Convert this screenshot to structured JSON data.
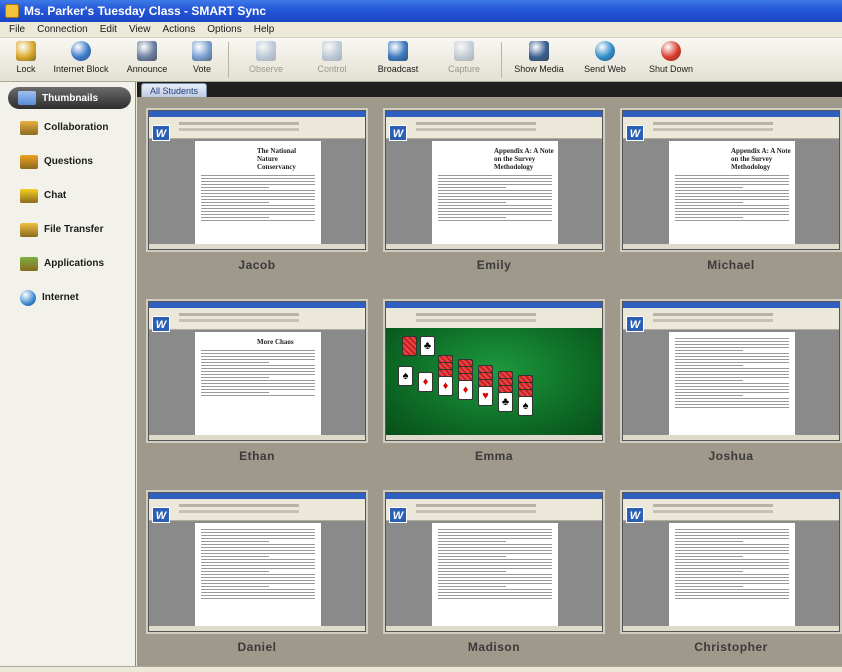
{
  "window": {
    "title": "Ms. Parker's Tuesday Class - SMART Sync"
  },
  "menu": [
    "File",
    "Connection",
    "Edit",
    "View",
    "Actions",
    "Options",
    "Help"
  ],
  "toolbar": [
    {
      "label": "Lock",
      "icon": "lock-icon",
      "color": "#d8a928",
      "enabled": true
    },
    {
      "label": "Internet Block",
      "icon": "globe-block-icon",
      "color": "#3a78c8",
      "enabled": true
    },
    {
      "label": "Announce",
      "icon": "announce-icon",
      "color": "#6b7fa0",
      "enabled": true
    },
    {
      "label": "Vote",
      "icon": "vote-icon",
      "color": "#7aa0d0",
      "enabled": true
    },
    {
      "label": "Observe",
      "icon": "observe-icon",
      "color": "#7a99c8",
      "enabled": false
    },
    {
      "label": "Control",
      "icon": "control-icon",
      "color": "#7a99c8",
      "enabled": false
    },
    {
      "label": "Broadcast",
      "icon": "broadcast-icon",
      "color": "#3c78c0",
      "enabled": true
    },
    {
      "label": "Capture",
      "icon": "capture-icon",
      "color": "#8aa0c0",
      "enabled": false
    },
    {
      "label": "Show Media",
      "icon": "film-icon",
      "color": "#3a5f90",
      "enabled": true
    },
    {
      "label": "Send Web",
      "icon": "send-web-icon",
      "color": "#2d8ac8",
      "enabled": true
    },
    {
      "label": "Shut Down",
      "icon": "power-icon",
      "color": "#d83a2a",
      "enabled": true
    }
  ],
  "sidebar": [
    {
      "label": "Thumbnails",
      "icon": "thumbnails-icon",
      "color": "#5a8ad8",
      "active": true
    },
    {
      "label": "Collaboration",
      "icon": "collaboration-icon",
      "color": "#e8b040",
      "active": false
    },
    {
      "label": "Questions",
      "icon": "questions-icon",
      "color": "#f0a020",
      "active": false
    },
    {
      "label": "Chat",
      "icon": "chat-icon",
      "color": "#f5d020",
      "active": false
    },
    {
      "label": "File Transfer",
      "icon": "folder-icon",
      "color": "#f0c040",
      "active": false
    },
    {
      "label": "Applications",
      "icon": "applications-icon",
      "color": "#7ab040",
      "active": false
    },
    {
      "label": "Internet",
      "icon": "internet-icon",
      "color": "#3a88d0",
      "active": false
    }
  ],
  "tabs": [
    {
      "label": "All Students"
    }
  ],
  "students": [
    {
      "name": "Jacob",
      "screen": "document",
      "headline": "The National Nature Conservancy"
    },
    {
      "name": "Emily",
      "screen": "document",
      "headline": "Appendix A: A Note on the Survey Methodology"
    },
    {
      "name": "Michael",
      "screen": "document",
      "headline": "Appendix A: A Note on the Survey Methodology"
    },
    {
      "name": "Ethan",
      "screen": "document",
      "headline": "More Chaos"
    },
    {
      "name": "Emma",
      "screen": "solitaire",
      "headline": ""
    },
    {
      "name": "Joshua",
      "screen": "document",
      "headline": ""
    },
    {
      "name": "Daniel",
      "screen": "document",
      "headline": ""
    },
    {
      "name": "Madison",
      "screen": "document",
      "headline": ""
    },
    {
      "name": "Christopher",
      "screen": "document",
      "headline": ""
    }
  ]
}
